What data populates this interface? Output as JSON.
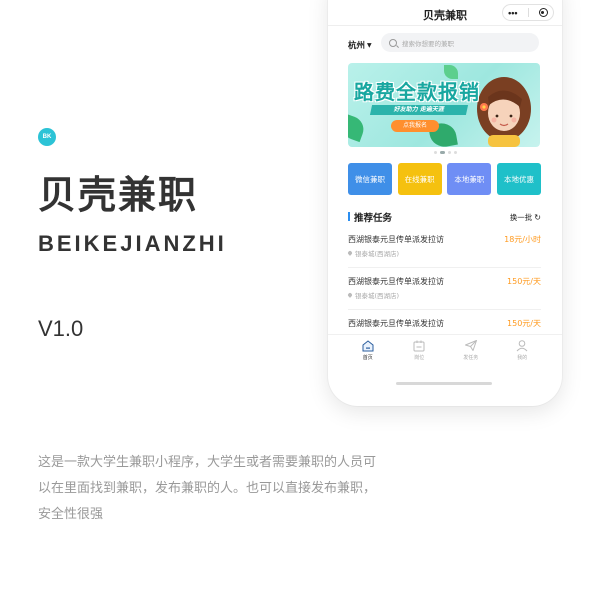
{
  "brand": {
    "badge": "BK",
    "title": "贝壳兼职",
    "pinyin": "BEIKEJIANZHI",
    "version": "V1.0",
    "description": [
      "这是一款大学生兼职小程序，大学生或者需要兼职的人员可",
      "以在里面找到兼职，发布兼职的人。也可以直接发布兼职，",
      "安全性很强"
    ]
  },
  "phone": {
    "nav": {
      "title": "贝壳兼职",
      "more_icon": "•••"
    },
    "city": "杭州",
    "search": {
      "placeholder": "搜索你想要的兼职"
    },
    "banner": {
      "title": "路费全款报销",
      "subtitle": "好友助力  走遍天涯",
      "button": "点我报名"
    },
    "tiles": [
      {
        "label": "微信兼职",
        "color": "#3f8fe8"
      },
      {
        "label": "在线兼职",
        "color": "#f5c10f"
      },
      {
        "label": "本地兼职",
        "color": "#6f8ef5"
      },
      {
        "label": "本地优惠",
        "color": "#1fc0c9"
      }
    ],
    "section": {
      "title": "推荐任务",
      "refresh": "换一批"
    },
    "jobs": [
      {
        "title": "西湖银泰元旦传单派发拉访",
        "location": "银泰城(西湖店)",
        "pay": "18元/小时"
      },
      {
        "title": "西湖银泰元旦传单派发拉访",
        "location": "银泰城(西湖店)",
        "pay": "150元/天"
      },
      {
        "title": "西湖银泰元旦传单派发拉访",
        "location": "",
        "pay": "150元/天"
      }
    ],
    "tabbar": [
      {
        "label": "首页",
        "icon": "home-icon"
      },
      {
        "label": "岗位",
        "icon": "calendar-icon"
      },
      {
        "label": "发任务",
        "icon": "send-icon"
      },
      {
        "label": "我的",
        "icon": "user-icon"
      }
    ],
    "colors": {
      "accent": "#2b8ef0",
      "pay": "#ff9a1f",
      "brand": "#2cc3d6"
    }
  }
}
